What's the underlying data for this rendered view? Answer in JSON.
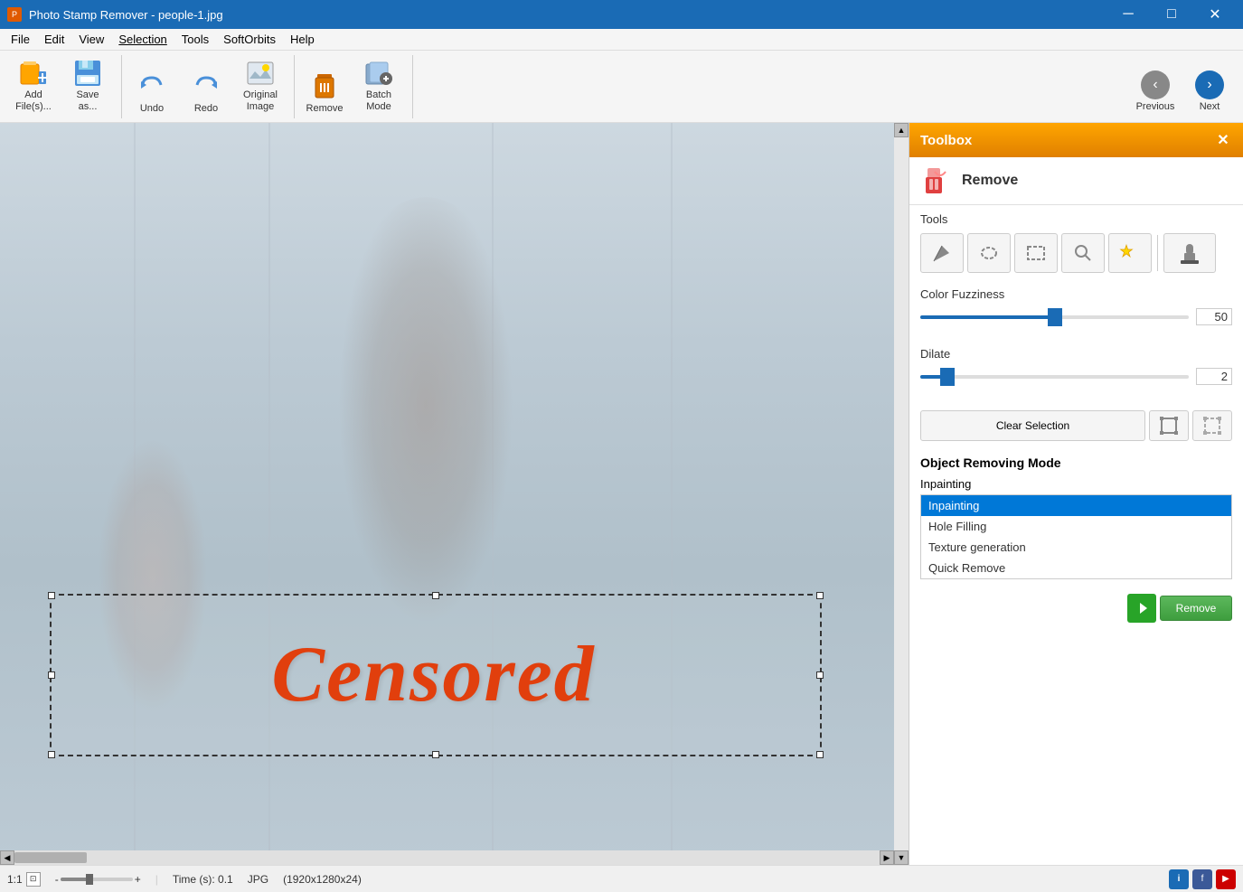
{
  "titleBar": {
    "title": "Photo Stamp Remover - people-1.jpg",
    "icon": "PSR",
    "controls": {
      "minimize": "─",
      "maximize": "□",
      "close": "✕"
    }
  },
  "menuBar": {
    "items": [
      "File",
      "Edit",
      "View",
      "Selection",
      "Tools",
      "SoftOrbits",
      "Help"
    ]
  },
  "toolbar": {
    "buttons": [
      {
        "id": "add-files",
        "label": "Add\nFile(s)...",
        "icon": "📂"
      },
      {
        "id": "save-as",
        "label": "Save\nas...",
        "icon": "💾"
      },
      {
        "id": "undo",
        "label": "Undo",
        "icon": "↩"
      },
      {
        "id": "redo",
        "label": "Redo",
        "icon": "↪"
      },
      {
        "id": "original-image",
        "label": "Original\nImage",
        "icon": "🖼"
      },
      {
        "id": "remove",
        "label": "Remove",
        "icon": "🔧"
      },
      {
        "id": "batch-mode",
        "label": "Batch\nMode",
        "icon": "⚙"
      }
    ],
    "nav": {
      "previous": "Previous",
      "next": "Next"
    }
  },
  "toolbox": {
    "title": "Toolbox",
    "removeLabel": "Remove",
    "close": "✕",
    "tools": {
      "label": "Tools",
      "buttons": [
        "pencil",
        "lasso",
        "rect-select",
        "magic-wand",
        "wand-plus",
        "stamp"
      ]
    },
    "colorFuzziness": {
      "label": "Color Fuzziness",
      "value": 50,
      "min": 0,
      "max": 100,
      "fillPercent": 50
    },
    "dilate": {
      "label": "Dilate",
      "value": 2,
      "min": 0,
      "max": 20,
      "fillPercent": 10
    },
    "clearSelectionLabel": "Clear Selection",
    "removeBtn": "Remove",
    "objectRemovingMode": {
      "title": "Object Removing Mode",
      "currentValue": "Inpainting",
      "options": [
        "Inpainting",
        "Hole Filling",
        "Texture generation",
        "Quick Remove"
      ]
    }
  },
  "canvas": {
    "censoredText": "Censored"
  },
  "statusBar": {
    "zoom": "1:1",
    "zoomMin": "-",
    "zoomMax": "+",
    "time": "Time (s): 0.1",
    "format": "JPG",
    "dimensions": "(1920x1280x24)"
  }
}
